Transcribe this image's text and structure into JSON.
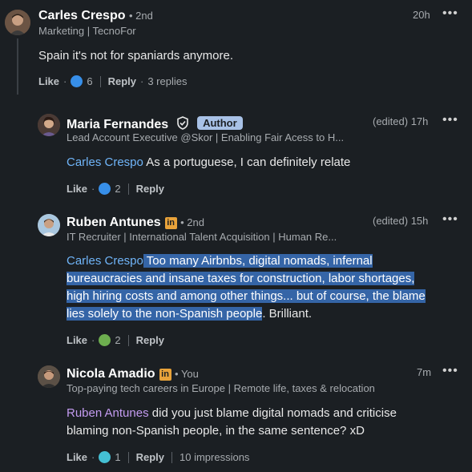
{
  "comments": [
    {
      "author": "Carles Crespo",
      "degree": "2nd",
      "headline": "Marketing | TecnoFor",
      "time": "20h",
      "text": "Spain it's not for spaniards anymore.",
      "like_label": "Like",
      "reaction_count": "6",
      "reply_label": "Reply",
      "replies_label": "3 replies"
    },
    {
      "author": "Maria Fernandes",
      "badge": "Author",
      "headline": "Lead Account Executive @Skor | Enabling Fair Acess to H...",
      "time": "(edited) 17h",
      "mention": "Carles Crespo",
      "text": "As a portuguese, I can definitely relate",
      "like_label": "Like",
      "reaction_count": "2",
      "reply_label": "Reply"
    },
    {
      "author": "Ruben Antunes",
      "degree": "2nd",
      "headline": "IT Recruiter | International Talent Acquisition | Human Re...",
      "time": "(edited) 15h",
      "mention": "Carles Crespo",
      "text_line1": "Too many Airbnbs, digital nomads, infernal",
      "text_line2": "bureaucracies and insane taxes for construction, labor shortages,",
      "text_line3": "high hiring costs and among other things... but of course, the blame",
      "text_line4_hl": "lies solely to the non-Spanish people",
      "text_line4_rest": ". Brilliant.",
      "like_label": "Like",
      "reaction_count": "2",
      "reply_label": "Reply"
    },
    {
      "author": "Nicola Amadio",
      "degree": "You",
      "headline": "Top-paying tech careers in Europe | Remote life, taxes & relocation",
      "time": "7m",
      "mention": "Ruben Antunes",
      "text_line1": "did you just blame digital nomads and criticise",
      "text_line2": "blaming non-Spanish people, in the same sentence? xD",
      "like_label": "Like",
      "reaction_count": "1",
      "reply_label": "Reply",
      "impressions": "10 impressions"
    }
  ],
  "colors": {
    "background": "#1b1f23",
    "mention_blue": "#70b5f9",
    "mention_purple": "#c39bf0",
    "highlight": "#3565a7",
    "linkedin_badge": "#e8a23a"
  },
  "icons": [
    "more-options-icon",
    "like-reaction-icon",
    "support-reaction-icon",
    "funny-reaction-icon",
    "verified-shield-icon",
    "linkedin-premium-icon"
  ]
}
